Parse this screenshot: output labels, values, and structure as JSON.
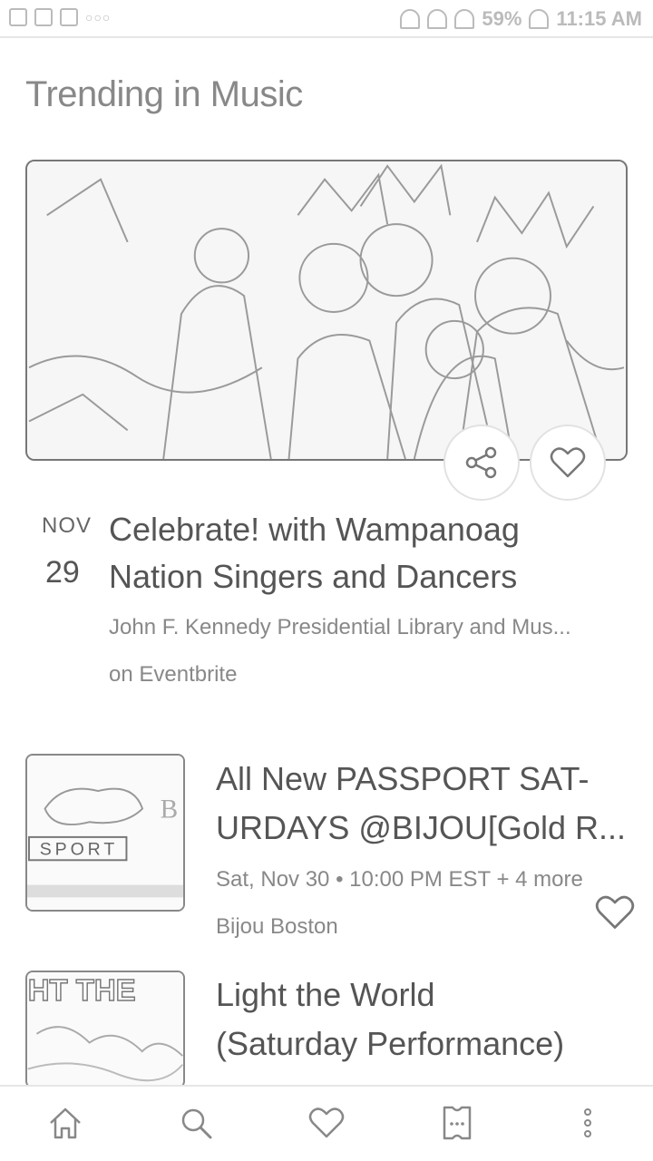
{
  "status_bar": {
    "battery": "59%",
    "time": "11:15 AM"
  },
  "section": {
    "title": "Trending in Music"
  },
  "featured_event": {
    "date_month": "NOV",
    "date_day": "29",
    "title_line1": "Celebrate! with Wampanoag",
    "title_line2": "Nation Singers and Dancers",
    "venue": "John F. Kennedy Presidential Library and Mus...",
    "source": "on Eventbrite"
  },
  "events": [
    {
      "title_line1": "All New PASSPORT SAT-",
      "title_line2": "URDAYS @BIJOU[Gold R...",
      "datetime": "Sat, Nov 30 • 10:00 PM EST + 4 more",
      "venue": "Bijou Boston",
      "thumb_text": "SPORT"
    },
    {
      "title_line1": "Light the World",
      "title_line2": "(Saturday Performance)",
      "thumb_text": "HT THE"
    }
  ],
  "nav": [
    "home-icon",
    "search-icon",
    "heart-icon",
    "ticket-icon",
    "more-icon"
  ],
  "colors": {
    "text_primary": "#555555",
    "text_secondary": "#888888",
    "border": "#e6e6e6"
  }
}
